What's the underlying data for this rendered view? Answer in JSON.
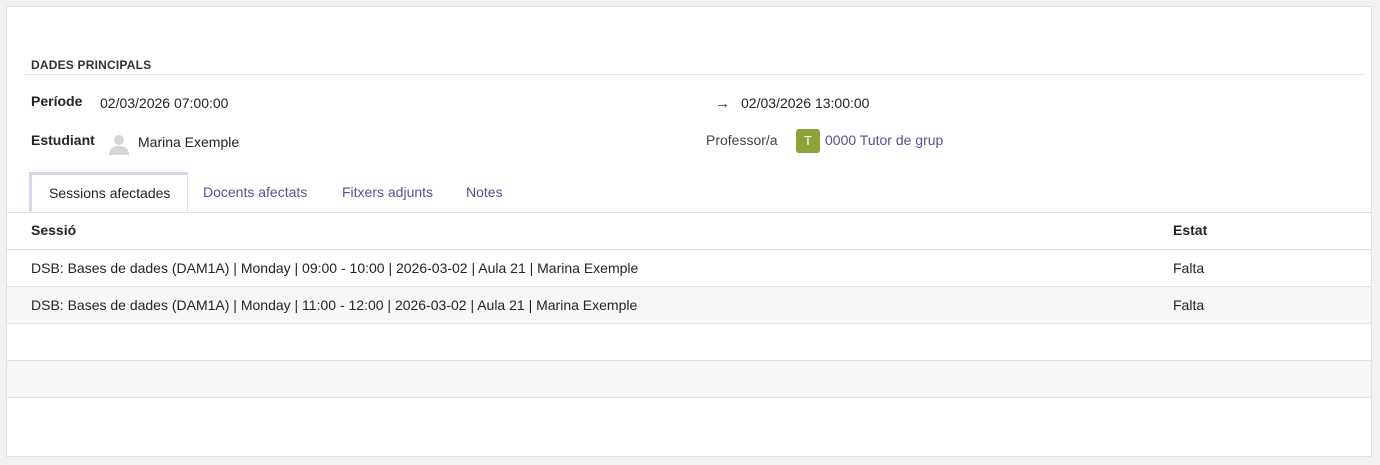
{
  "section": {
    "title": "DADES PRINCIPALS"
  },
  "period": {
    "label": "Període",
    "start": "02/03/2026 07:00:00",
    "arrow": "→",
    "end": "02/03/2026 13:00:00"
  },
  "student": {
    "label": "Estudiant",
    "name": "Marina Exemple",
    "icon": "user-avatar-icon"
  },
  "teacher": {
    "label": "Professor/a",
    "initial": "T",
    "name": "0000 Tutor de grup",
    "badge_color": "#8da33a"
  },
  "tabs": [
    {
      "label": "Sessions afectades",
      "active": true
    },
    {
      "label": "Docents afectats",
      "active": false
    },
    {
      "label": "Fitxers adjunts",
      "active": false
    },
    {
      "label": "Notes",
      "active": false
    }
  ],
  "table": {
    "headers": {
      "session": "Sessió",
      "status": "Estat"
    },
    "rows": [
      {
        "session": "DSB: Bases de dades (DAM1A) | Monday | 09:00 - 10:00 | 2026-03-02 | Aula 21 | Marina Exemple",
        "status": "Falta"
      },
      {
        "session": "DSB: Bases de dades (DAM1A) | Monday | 11:00 - 12:00 | 2026-03-02 | Aula 21 | Marina Exemple",
        "status": "Falta"
      }
    ]
  },
  "colors": {
    "link": "#5b4f96",
    "tab_active_border": "#d8d5e8"
  }
}
